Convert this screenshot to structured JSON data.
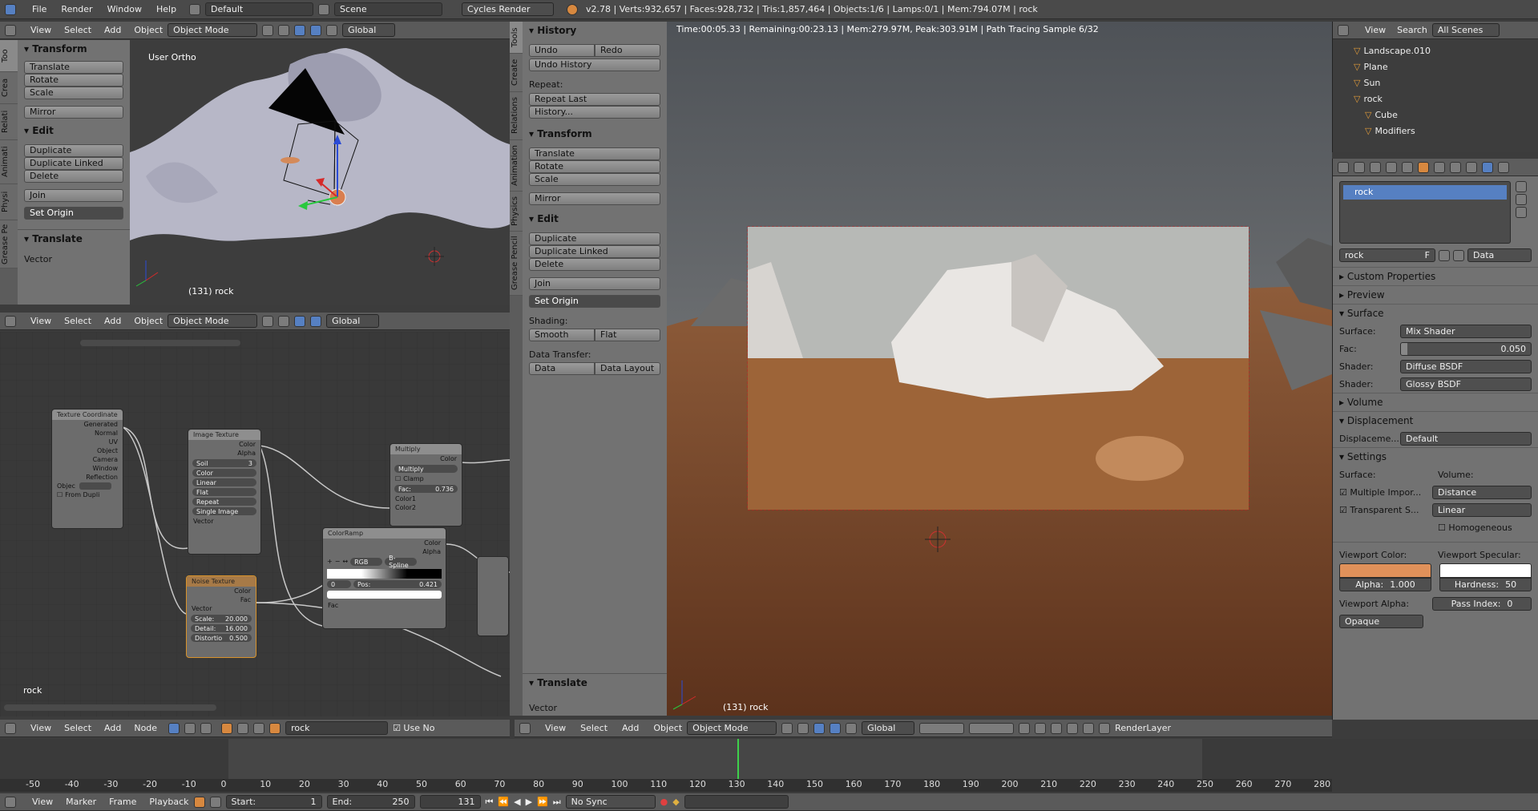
{
  "topbar": {
    "menus": [
      "File",
      "Render",
      "Window",
      "Help"
    ],
    "layout": "Default",
    "scene": "Scene",
    "engine": "Cycles Render",
    "stats": "v2.78 | Verts:932,657 | Faces:928,732 | Tris:1,857,464 | Objects:1/6 | Lamps:0/1 | Mem:794.07M | rock"
  },
  "viewport_header": {
    "menus": [
      "View",
      "Select",
      "Add",
      "Object"
    ],
    "mode": "Object Mode",
    "orientation": "Global"
  },
  "tool_shelf": {
    "tabs": [
      "Too",
      "Crea",
      "Relati",
      "Animati",
      "Physi",
      "Grease Pe"
    ],
    "transform_title": "Transform",
    "transform_buttons": [
      "Translate",
      "Rotate",
      "Scale"
    ],
    "mirror": "Mirror",
    "edit_title": "Edit",
    "edit_buttons": [
      "Duplicate",
      "Duplicate Linked",
      "Delete"
    ],
    "join": "Join",
    "set_origin": "Set Origin",
    "translate_title": "Translate",
    "vector": "Vector"
  },
  "viewport_small": {
    "label": "User Ortho",
    "object": "(131) rock"
  },
  "node_editor": {
    "menus": [
      "View",
      "Select",
      "Add",
      "Node"
    ],
    "material": "rock",
    "use_nodes": "Use No",
    "label": "rock",
    "tex_coord": {
      "title": "Texture Coordinate",
      "outputs": [
        "Generated",
        "Normal",
        "UV",
        "Object",
        "Camera",
        "Window",
        "Reflection"
      ],
      "object_label": "Objec",
      "from_dupli": "From Dupli"
    },
    "image_tex": {
      "title": "Image Texture",
      "outputs": [
        "Color",
        "Alpha"
      ],
      "image": "Soil",
      "users": "3",
      "opts": [
        "Color",
        "Linear",
        "Flat",
        "Repeat",
        "Single Image"
      ],
      "input": "Vector"
    },
    "multiply": {
      "title": "Multiply",
      "output": "Color",
      "op": "Multiply",
      "clamp": "Clamp",
      "fac_label": "Fac:",
      "fac": "0.736",
      "inputs": [
        "Color1",
        "Color2"
      ]
    },
    "colorramp": {
      "title": "ColorRamp",
      "outputs": [
        "Color",
        "Alpha"
      ],
      "mode": "RGB",
      "interp": "B-Spline",
      "index": "0",
      "pos_label": "Pos:",
      "pos": "0.421",
      "input": "Fac"
    },
    "noise": {
      "title": "Noise Texture",
      "outputs": [
        "Color",
        "Fac"
      ],
      "input": "Vector",
      "scale_label": "Scale:",
      "scale": "20.000",
      "detail_label": "Detail:",
      "detail": "16.000",
      "distortion_label": "Distortio",
      "distortion": "0.500"
    }
  },
  "tool_shelf2": {
    "tabs": [
      "Tools",
      "Create",
      "Relations",
      "Animation",
      "Physics",
      "Grease Pencil"
    ],
    "history_title": "History",
    "undo": "Undo",
    "redo": "Redo",
    "undo_history": "Undo History",
    "repeat_label": "Repeat:",
    "repeat_last": "Repeat Last",
    "history_btn": "History...",
    "transform_title": "Transform",
    "transform_buttons": [
      "Translate",
      "Rotate",
      "Scale"
    ],
    "mirror": "Mirror",
    "edit_title": "Edit",
    "edit_buttons": [
      "Duplicate",
      "Duplicate Linked",
      "Delete"
    ],
    "join": "Join",
    "set_origin": "Set Origin",
    "shading_label": "Shading:",
    "smooth": "Smooth",
    "flat": "Flat",
    "data_transfer_label": "Data Transfer:",
    "data": "Data",
    "data_layout": "Data Layout",
    "translate_title": "Translate",
    "vector": "Vector"
  },
  "render_view": {
    "status": "Time:00:05.33 | Remaining:00:23.13 | Mem:279.97M, Peak:303.91M | Path Tracing Sample 6/32",
    "object": "(131) rock",
    "header_menus": [
      "View",
      "Select",
      "Add",
      "Object"
    ],
    "mode": "Object Mode",
    "orientation": "Global",
    "render_layer": "RenderLayer"
  },
  "outliner": {
    "menus": [
      "View",
      "Search"
    ],
    "scope": "All Scenes",
    "items": [
      {
        "name": "Landscape.010",
        "indent": 1
      },
      {
        "name": "Plane",
        "indent": 1
      },
      {
        "name": "Sun",
        "indent": 1
      },
      {
        "name": "rock",
        "indent": 1
      },
      {
        "name": "Cube",
        "indent": 2
      },
      {
        "name": "Modifiers",
        "indent": 2
      }
    ]
  },
  "properties": {
    "material_slot": "rock",
    "material_name": "rock",
    "f_label": "F",
    "link": "Data",
    "sections": {
      "custom": "Custom Properties",
      "preview": "Preview",
      "surface": "Surface",
      "volume": "Volume",
      "displacement": "Displacement",
      "settings": "Settings"
    },
    "surface_label": "Surface:",
    "surface_value": "Mix Shader",
    "fac_label": "Fac:",
    "fac_value": "0.050",
    "shader_label": "Shader:",
    "shader1": "Diffuse BSDF",
    "shader2": "Glossy BSDF",
    "displacement_label": "Displaceme...",
    "displacement_value": "Default",
    "settings_surface": "Surface:",
    "settings_volume": "Volume:",
    "multiple_importance": "Multiple Impor...",
    "transparent_shadows": "Transparent S...",
    "volume_sampling": "Distance",
    "volume_interp": "Linear",
    "homogeneous": "Homogeneous",
    "viewport_color_label": "Viewport Color:",
    "viewport_specular_label": "Viewport Specular:",
    "viewport_color": "#e0915a",
    "alpha_label": "Alpha:",
    "alpha": "1.000",
    "hardness_label": "Hardness:",
    "hardness": "50",
    "viewport_alpha_label": "Viewport Alpha:",
    "viewport_alpha": "Opaque",
    "pass_index_label": "Pass Index:",
    "pass_index": "0"
  },
  "timeline": {
    "ticks": [
      "-50",
      "-40",
      "-30",
      "-20",
      "-10",
      "0",
      "10",
      "20",
      "30",
      "40",
      "50",
      "60",
      "70",
      "80",
      "90",
      "100",
      "110",
      "120",
      "130",
      "140",
      "150",
      "160",
      "170",
      "180",
      "190",
      "200",
      "210",
      "220",
      "230",
      "240",
      "250",
      "260",
      "270",
      "280"
    ],
    "menus": [
      "View",
      "Marker",
      "Frame",
      "Playback"
    ],
    "start_label": "Start:",
    "start": "1",
    "end_label": "End:",
    "end": "250",
    "current": "131",
    "sync": "No Sync"
  }
}
